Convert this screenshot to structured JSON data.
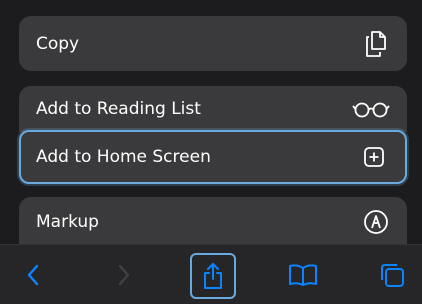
{
  "actions": [
    {
      "label": "Copy",
      "icon": "copy-doc-icon"
    },
    {
      "label": "Add to Reading List",
      "icon": "glasses-icon"
    },
    {
      "label": "Add to Home Screen",
      "icon": "plus-square-icon",
      "selected": true
    },
    {
      "label": "Markup",
      "icon": "markup-pen-icon"
    }
  ],
  "toolbar": {
    "back_icon": "chevron-left-icon",
    "forward_icon": "chevron-right-icon",
    "share_icon": "share-icon",
    "bookmarks_icon": "book-icon",
    "tabs_icon": "tabs-icon"
  },
  "colors": {
    "background": "#1c1c1e",
    "row": "#3a3a3c",
    "accent": "#0a84ff",
    "focus_ring": "#6aa9de",
    "text": "#ffffff"
  }
}
